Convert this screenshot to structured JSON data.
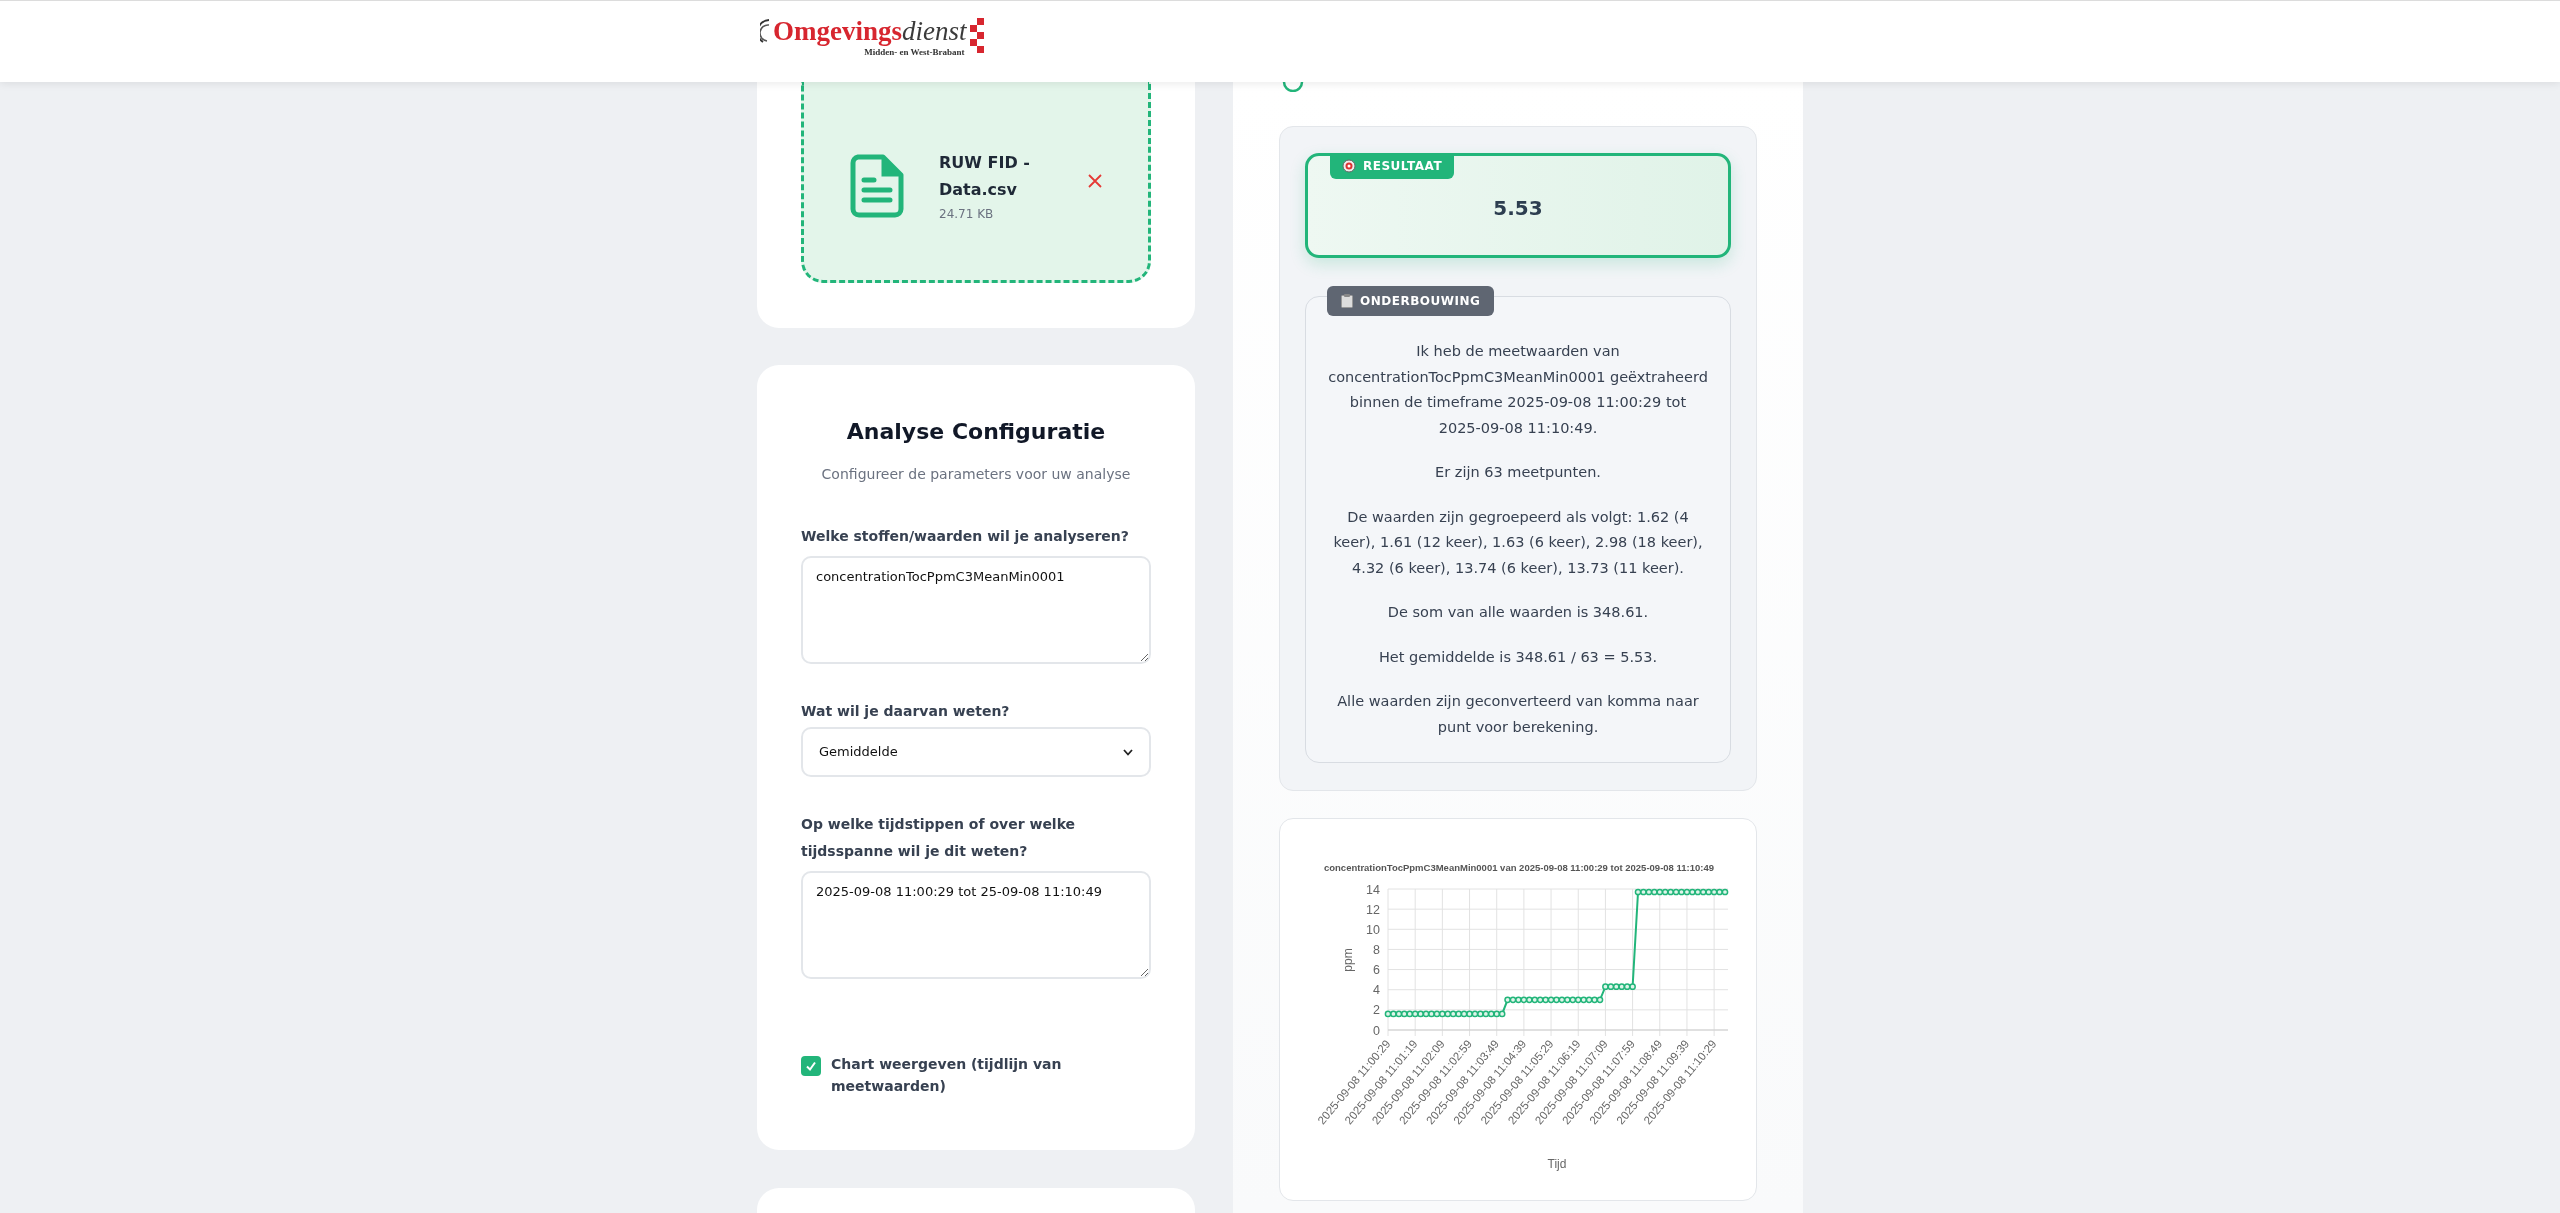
{
  "header": {
    "logo": {
      "name_first": "Omgevings",
      "name_second": "dienst",
      "tagline": "Midden- en West-Brabant"
    }
  },
  "upload": {
    "file_name": "RUW FID - Data.csv",
    "file_size": "24.71 KB"
  },
  "config": {
    "title": "Analyse Configuratie",
    "subtitle": "Configureer de parameters voor uw analyse",
    "fields": [
      {
        "kind": "textarea",
        "label": "Welke stoffen/waarden wil je analyseren?",
        "value": "concentrationTocPpmC3MeanMin0001"
      },
      {
        "kind": "select",
        "label": "Wat wil je daarvan weten?",
        "value": "Gemiddelde"
      },
      {
        "kind": "textarea",
        "label": "Op welke tijdstippen of over welke tijdsspanne wil je dit weten?",
        "value": "2025-09-08 11:00:29 tot 25-09-08 11:10:49"
      },
      {
        "kind": "checkbox",
        "label": "Chart weergeven (tijdlijn van meetwaarden)",
        "checked": true
      }
    ]
  },
  "result": {
    "badge": "RESULTAAT",
    "value": "5.53"
  },
  "explanation": {
    "badge": "ONDERBOUWING",
    "paragraphs": [
      "Ik heb de meetwaarden van concentrationTocPpmC3MeanMin0001 geëxtraheerd binnen de timeframe 2025-09-08 11:00:29 tot 2025-09-08 11:10:49.",
      "Er zijn 63 meetpunten.",
      "De waarden zijn gegroepeerd als volgt: 1.62 (4 keer), 1.61 (12 keer), 1.63 (6 keer), 2.98 (18 keer), 4.32 (6 keer), 13.74 (6 keer), 13.73 (11 keer).",
      "De som van alle waarden is 348.61.",
      "Het gemiddelde is 348.61 / 63 = 5.53.",
      "Alle waarden zijn geconverteerd van komma naar punt voor berekening."
    ]
  },
  "chart": {
    "chart_data": {
      "type": "line",
      "title": "concentrationTocPpmC3MeanMin0001 van 2025-09-08 11:00:29 tot 2025-09-08 11:10:49",
      "xlabel": "Tijd",
      "ylabel": "ppm",
      "categories": [
        "2025-09-08 11:00:29",
        null,
        null,
        null,
        null,
        "2025-09-08 11:01:19",
        null,
        null,
        null,
        null,
        "2025-09-08 11:02:09",
        null,
        null,
        null,
        null,
        "2025-09-08 11:02:59",
        null,
        null,
        null,
        null,
        "2025-09-08 11:03:49",
        null,
        null,
        null,
        null,
        "2025-09-08 11:04:39",
        null,
        null,
        null,
        null,
        "2025-09-08 11:05:29",
        null,
        null,
        null,
        null,
        "2025-09-08 11:06:19",
        null,
        null,
        null,
        null,
        "2025-09-08 11:07:09",
        null,
        null,
        null,
        null,
        "2025-09-08 11:07:59",
        null,
        null,
        null,
        null,
        "2025-09-08 11:08:49",
        null,
        null,
        null,
        null,
        "2025-09-08 11:09:39",
        null,
        null,
        null,
        null,
        "2025-09-08 11:10:29",
        null,
        null
      ],
      "ylim": [
        0,
        14
      ],
      "grid": true,
      "yticks": [
        0,
        2,
        4,
        6,
        8,
        10,
        12,
        14
      ],
      "series": [
        {
          "color": "#22b57a",
          "marker": true,
          "values": [
            1.6,
            1.6,
            1.6,
            1.6,
            1.6,
            1.6,
            1.6,
            1.6,
            1.6,
            1.6,
            1.6,
            1.6,
            1.6,
            1.6,
            1.6,
            1.6,
            1.6,
            1.6,
            1.6,
            1.6,
            1.6,
            1.6,
            3.0,
            3.0,
            3.0,
            3.0,
            3.0,
            3.0,
            3.0,
            3.0,
            3.0,
            3.0,
            3.0,
            3.0,
            3.0,
            3.0,
            3.0,
            3.0,
            3.0,
            3.0,
            4.3,
            4.3,
            4.3,
            4.3,
            4.3,
            4.3,
            13.7,
            13.7,
            13.7,
            13.7,
            13.7,
            13.7,
            13.7,
            13.7,
            13.7,
            13.7,
            13.7,
            13.7,
            13.7,
            13.7,
            13.7,
            13.7,
            13.7
          ]
        }
      ]
    }
  }
}
